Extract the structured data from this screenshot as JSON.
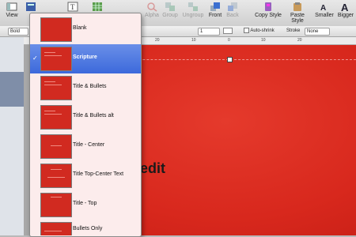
{
  "toolbar": {
    "items": [
      {
        "label": "View",
        "icon": "view-icon",
        "enabled": true
      },
      {
        "label": "Alpha",
        "icon": "alpha-icon",
        "enabled": false
      },
      {
        "label": "Group",
        "icon": "group-icon",
        "enabled": false
      },
      {
        "label": "Ungroup",
        "icon": "ungroup-icon",
        "enabled": false
      },
      {
        "label": "Front",
        "icon": "front-icon",
        "enabled": true
      },
      {
        "label": "Back",
        "icon": "back-icon",
        "enabled": false
      },
      {
        "label": "Copy Style",
        "icon": "copy-style-icon",
        "enabled": true
      },
      {
        "label": "Paste Style",
        "icon": "paste-style-icon",
        "enabled": true
      },
      {
        "label": "Smaller",
        "icon": "smaller-icon",
        "enabled": true
      },
      {
        "label": "Bigger",
        "icon": "bigger-icon",
        "enabled": true
      }
    ]
  },
  "format_bar": {
    "font_style": "Bold",
    "line_spacing": "1",
    "autoshrink_label": "Auto-shrink",
    "stroke_label": "Stroke",
    "stroke_value": "None"
  },
  "ruler": {
    "ticks": [
      "20",
      "10",
      "0",
      "10",
      "20"
    ]
  },
  "slide": {
    "placeholder_text": "k to edit",
    "background_color": "#d8281d"
  },
  "master_menu": {
    "selected_index": 1,
    "items": [
      {
        "label": "Blank"
      },
      {
        "label": "Scripture"
      },
      {
        "label": "Title & Bullets"
      },
      {
        "label": "Title & Bullets alt"
      },
      {
        "label": "Title - Center"
      },
      {
        "label": "Title Top-Center Text"
      },
      {
        "label": "Title - Top"
      },
      {
        "label": "Bullets Only"
      }
    ]
  },
  "colors": {
    "selection": "#3c69db",
    "menu_bg": "#fcecec",
    "slide_red": "#d8281d"
  }
}
